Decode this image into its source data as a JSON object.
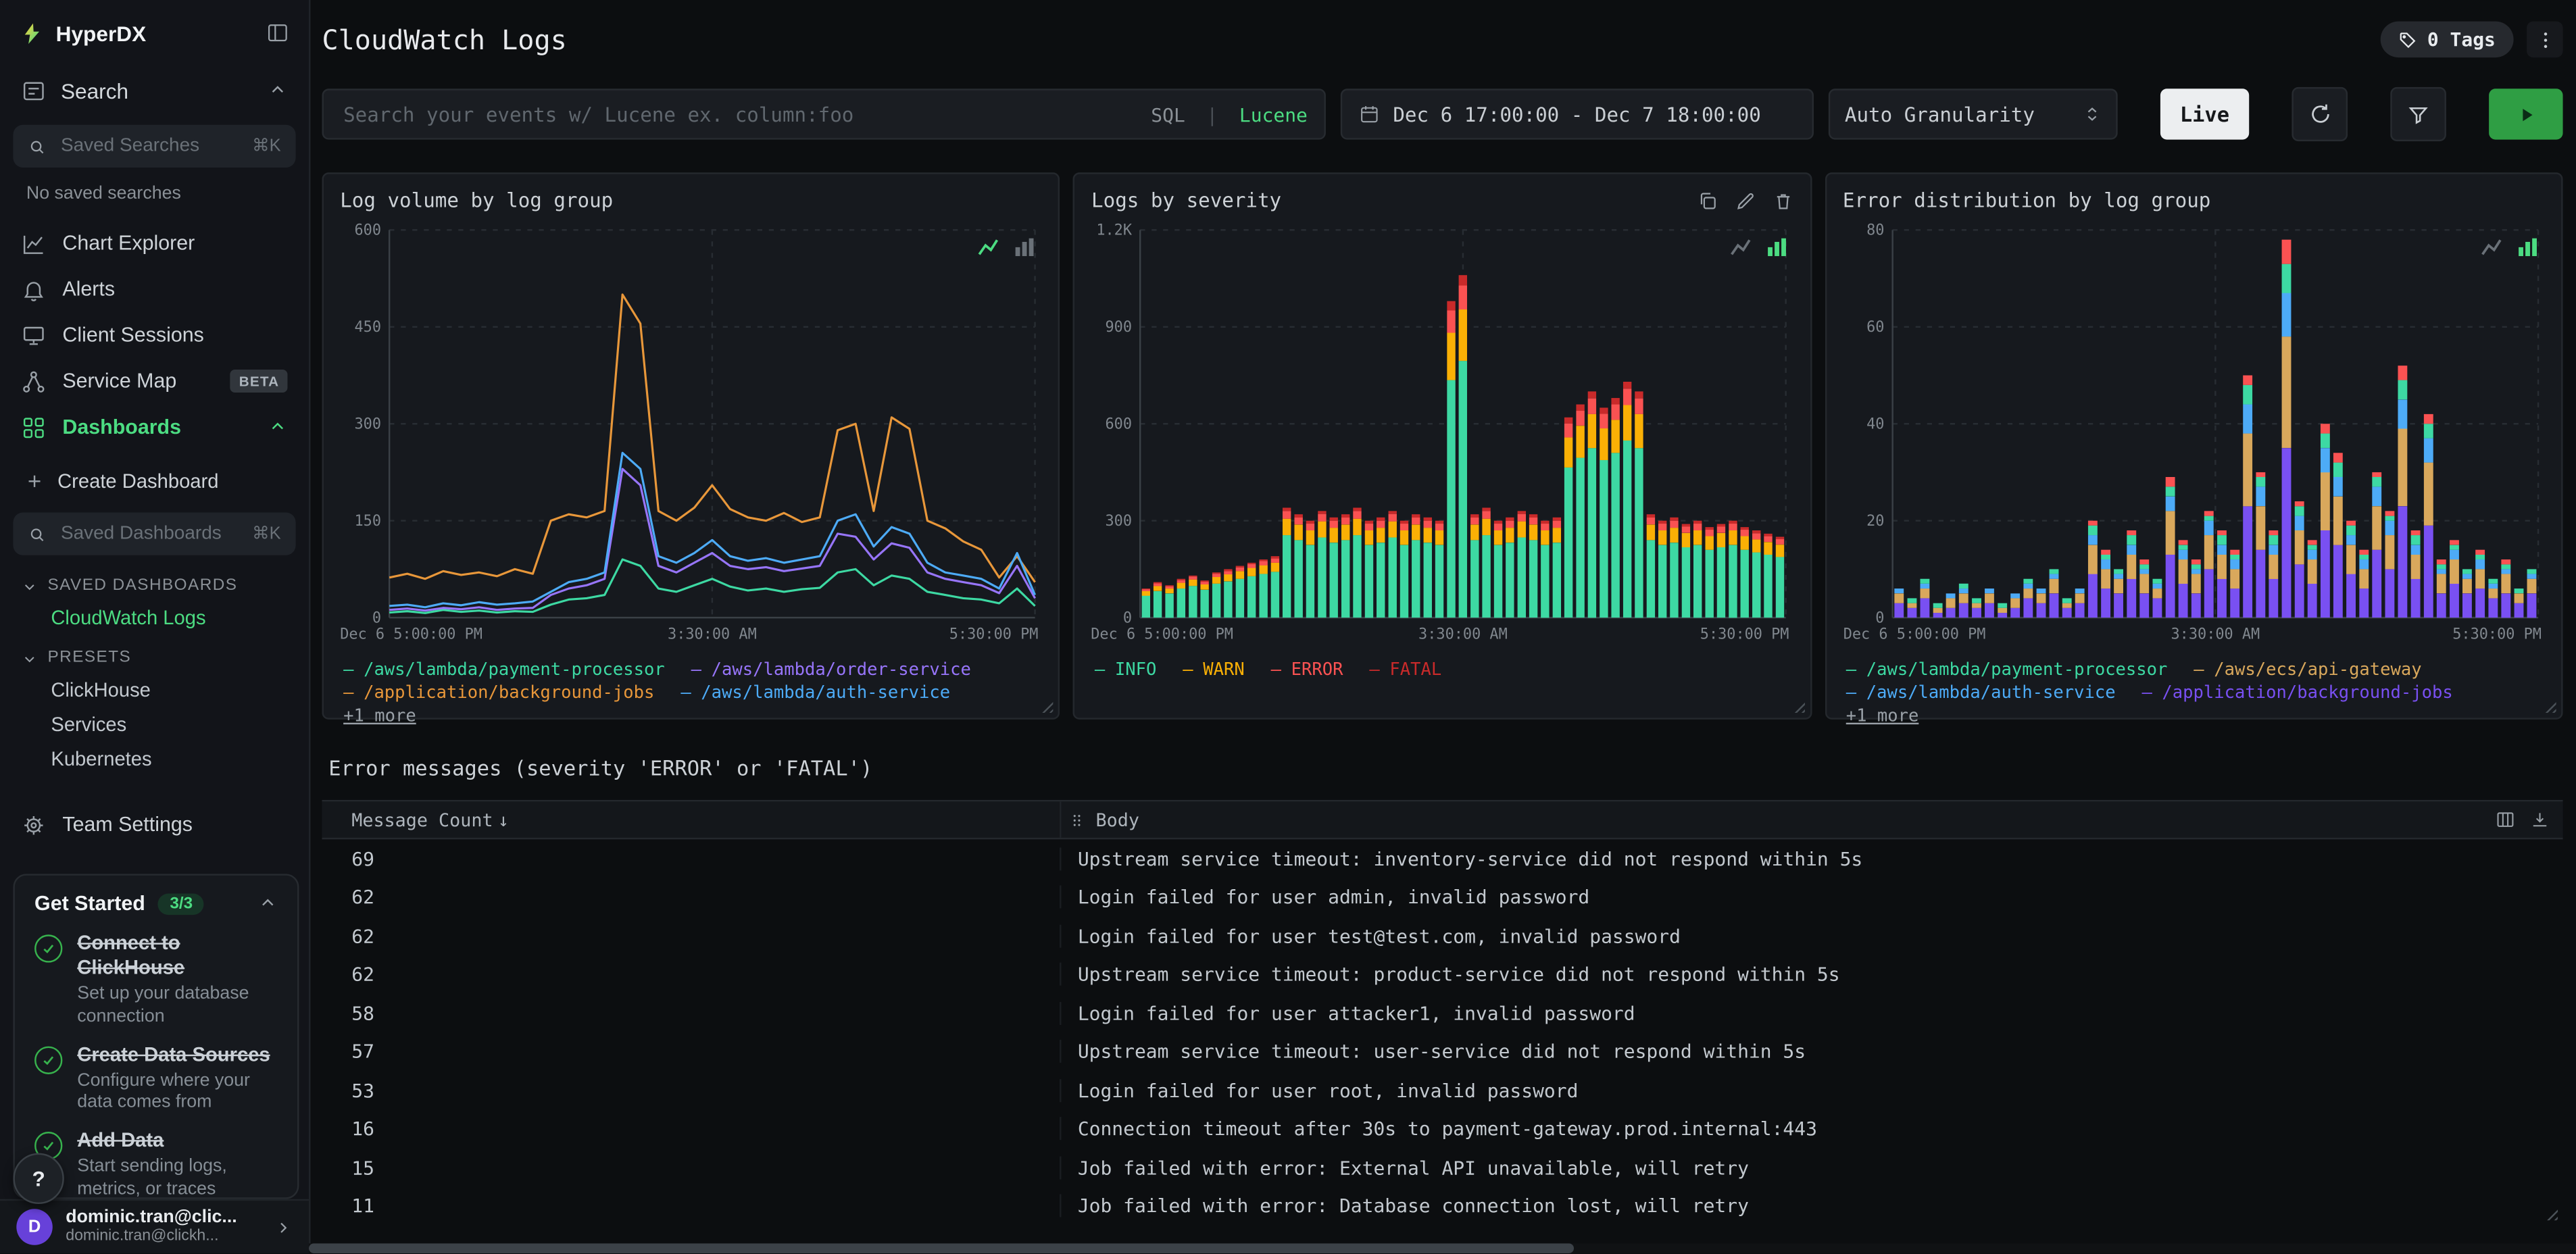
{
  "sidebar": {
    "logo_text": "HyperDX",
    "search": {
      "label": "Search"
    },
    "saved_searches": {
      "placeholder": "Saved Searches",
      "shortcut": "⌘K"
    },
    "no_saved_searches": "No saved searches",
    "nav": [
      {
        "label": "Chart Explorer"
      },
      {
        "label": "Alerts"
      },
      {
        "label": "Client Sessions"
      },
      {
        "label": "Service Map",
        "badge": "BETA"
      },
      {
        "label": "Dashboards"
      }
    ],
    "create_dashboard": "Create Dashboard",
    "saved_dashboards_input": {
      "placeholder": "Saved Dashboards",
      "shortcut": "⌘K"
    },
    "saved_dashboards_section": "SAVED DASHBOARDS",
    "saved_dashboards": [
      {
        "label": "CloudWatch Logs"
      }
    ],
    "presets_section": "PRESETS",
    "presets": [
      "ClickHouse",
      "Services",
      "Kubernetes"
    ],
    "team_settings": "Team Settings",
    "get_started": {
      "title": "Get Started",
      "badge": "3/3",
      "steps": [
        {
          "title": "Connect to ClickHouse",
          "desc": "Set up your database connection"
        },
        {
          "title": "Create Data Sources",
          "desc": "Configure where your data comes from"
        },
        {
          "title": "Add Data",
          "desc": "Start sending logs, metrics, or traces"
        }
      ]
    },
    "help": "?",
    "user": {
      "initial": "D",
      "name": "dominic.tran@clic...",
      "email": "dominic.tran@clickh..."
    }
  },
  "header": {
    "title": "CloudWatch Logs",
    "tags": "0 Tags"
  },
  "toolbar": {
    "search_placeholder": "Search your events w/ Lucene ex. column:foo",
    "sql": "SQL",
    "sep": "|",
    "lucene": "Lucene",
    "time_range": "Dec 6 17:00:00 - Dec 7 18:00:00",
    "granularity": "Auto Granularity",
    "live": "Live"
  },
  "errors": {
    "title": "Error messages (severity 'ERROR' or 'FATAL')"
  },
  "table": {
    "col_count": "Message Count",
    "sort_indicator": "↓",
    "col_body": "Body",
    "rows": [
      {
        "count": "69",
        "body": "Upstream service timeout: inventory-service did not respond within 5s"
      },
      {
        "count": "62",
        "body": "Login failed for user admin, invalid password"
      },
      {
        "count": "62",
        "body": "Login failed for user test@test.com, invalid password"
      },
      {
        "count": "62",
        "body": "Upstream service timeout: product-service did not respond within 5s"
      },
      {
        "count": "58",
        "body": "Login failed for user attacker1, invalid password"
      },
      {
        "count": "57",
        "body": "Upstream service timeout: user-service did not respond within 5s"
      },
      {
        "count": "53",
        "body": "Login failed for user root, invalid password"
      },
      {
        "count": "16",
        "body": "Connection timeout after 30s to payment-gateway.prod.internal:443"
      },
      {
        "count": "15",
        "body": "Job failed with error: External API unavailable, will retry"
      },
      {
        "count": "11",
        "body": "Job failed with error: Database connection lost, will retry"
      }
    ]
  },
  "chart_data": [
    {
      "type": "line",
      "title": "Log volume by log group",
      "ymax": 600,
      "yticks": [
        0,
        150,
        300,
        450,
        600
      ],
      "ytick_labels": [
        "0",
        "150",
        "300",
        "450",
        "600"
      ],
      "xtick_labels": [
        "Dec 6 5:00:00 PM",
        "3:30:00 AM",
        "5:30:00 PM"
      ],
      "series": [
        {
          "name": "/aws/lambda/payment-processor",
          "color": "#3dd9a3",
          "values": [
            8,
            10,
            7,
            12,
            9,
            11,
            8,
            10,
            9,
            20,
            28,
            30,
            35,
            90,
            80,
            45,
            40,
            50,
            60,
            48,
            42,
            45,
            40,
            44,
            46,
            70,
            75,
            50,
            65,
            60,
            40,
            35,
            30,
            28,
            22,
            45,
            18
          ]
        },
        {
          "name": "/aws/lambda/order-service",
          "color": "#9775fa",
          "values": [
            12,
            14,
            11,
            15,
            13,
            16,
            12,
            14,
            15,
            35,
            45,
            50,
            60,
            230,
            205,
            80,
            70,
            85,
            100,
            80,
            75,
            78,
            72,
            76,
            80,
            130,
            125,
            90,
            115,
            108,
            70,
            60,
            55,
            50,
            38,
            80,
            30
          ]
        },
        {
          "name": "/application/background-jobs",
          "color": "#e8973a",
          "values": [
            62,
            68,
            60,
            72,
            66,
            70,
            64,
            75,
            68,
            150,
            160,
            155,
            165,
            500,
            455,
            165,
            150,
            170,
            205,
            168,
            155,
            150,
            162,
            148,
            155,
            290,
            300,
            165,
            310,
            292,
            150,
            138,
            118,
            105,
            62,
            95,
            55
          ]
        },
        {
          "name": "/aws/lambda/auth-service",
          "color": "#4dabf7",
          "values": [
            18,
            20,
            16,
            22,
            19,
            24,
            20,
            22,
            25,
            40,
            55,
            60,
            70,
            255,
            230,
            95,
            85,
            100,
            120,
            95,
            88,
            92,
            85,
            90,
            95,
            150,
            160,
            110,
            140,
            130,
            85,
            70,
            65,
            60,
            45,
            100,
            35
          ]
        }
      ],
      "legend": [
        {
          "label": "/aws/lambda/payment-processor",
          "color": "#3dd9a3"
        },
        {
          "label": "/aws/lambda/order-service",
          "color": "#9775fa"
        },
        {
          "label": "/application/background-jobs",
          "color": "#e8973a"
        },
        {
          "label": "/aws/lambda/auth-service",
          "color": "#4dabf7"
        },
        {
          "label": "+1 more",
          "color": "#9aa1a8",
          "underline": true,
          "no_dash": true
        }
      ]
    },
    {
      "type": "stacked_bar",
      "title": "Logs by severity",
      "ymax": 1200,
      "yticks": [
        0,
        300,
        600,
        900,
        1200
      ],
      "ytick_labels": [
        "0",
        "300",
        "600",
        "900",
        "1.2K"
      ],
      "xtick_labels": [
        "Dec 6 5:00:00 PM",
        "3:30:00 AM",
        "5:30:00 PM"
      ],
      "series": [
        {
          "name": "INFO",
          "color": "#3dd9a3",
          "values": [
            68,
            82,
            75,
            90,
            98,
            86,
            105,
            112,
            120,
            128,
            135,
            142,
            255,
            240,
            225,
            248,
            232,
            240,
            255,
            225,
            232,
            248,
            225,
            240,
            232,
            225,
            735,
            795,
            240,
            255,
            225,
            232,
            248,
            240,
            225,
            232,
            465,
            495,
            525,
            488,
            510,
            548,
            525,
            240,
            225,
            232,
            218,
            225,
            210,
            218,
            225,
            210,
            202,
            195,
            188
          ]
        },
        {
          "name": "WARN",
          "color": "#fab005",
          "values": [
            14,
            16,
            15,
            18,
            20,
            17,
            21,
            22,
            24,
            26,
            27,
            28,
            51,
            48,
            45,
            50,
            46,
            48,
            51,
            45,
            46,
            50,
            45,
            48,
            46,
            45,
            147,
            159,
            48,
            51,
            45,
            46,
            50,
            48,
            45,
            46,
            93,
            99,
            105,
            98,
            102,
            110,
            105,
            48,
            45,
            46,
            44,
            45,
            42,
            44,
            45,
            42,
            40,
            39,
            38
          ]
        },
        {
          "name": "ERROR",
          "color": "#fa5252",
          "values": [
            6,
            8,
            7,
            8,
            9,
            8,
            10,
            10,
            11,
            12,
            13,
            13,
            24,
            22,
            21,
            23,
            22,
            22,
            24,
            21,
            22,
            23,
            21,
            22,
            22,
            21,
            69,
            74,
            22,
            24,
            21,
            22,
            23,
            22,
            21,
            22,
            43,
            46,
            49,
            45,
            48,
            51,
            49,
            22,
            21,
            22,
            20,
            21,
            20,
            20,
            21,
            20,
            19,
            18,
            17
          ]
        },
        {
          "name": "FATAL",
          "color": "#c92a2a",
          "values": [
            2,
            4,
            3,
            4,
            3,
            4,
            4,
            6,
            5,
            4,
            5,
            7,
            10,
            10,
            9,
            9,
            10,
            10,
            10,
            9,
            10,
            9,
            9,
            10,
            10,
            9,
            29,
            32,
            10,
            10,
            9,
            10,
            9,
            10,
            9,
            10,
            19,
            20,
            21,
            19,
            20,
            21,
            21,
            10,
            9,
            10,
            8,
            9,
            8,
            8,
            9,
            8,
            9,
            8,
            7
          ]
        }
      ],
      "legend": [
        {
          "label": "INFO",
          "color": "#3dd9a3"
        },
        {
          "label": "WARN",
          "color": "#fab005"
        },
        {
          "label": "ERROR",
          "color": "#fa5252"
        },
        {
          "label": "FATAL",
          "color": "#c92a2a"
        }
      ]
    },
    {
      "type": "stacked_bar",
      "title": "Error distribution by log group",
      "ymax": 80,
      "yticks": [
        0,
        20,
        40,
        60,
        80
      ],
      "ytick_labels": [
        "0",
        "20",
        "40",
        "60",
        "80"
      ],
      "xtick_labels": [
        "Dec 6 5:00:00 PM",
        "3:30:00 AM",
        "5:30:00 PM"
      ],
      "series": [
        {
          "name": "/application/background-jobs",
          "color": "#7950f2",
          "values": [
            3,
            2,
            4,
            1,
            2,
            3,
            2,
            3,
            1,
            2,
            4,
            3,
            5,
            2,
            3,
            9,
            6,
            5,
            8,
            5,
            4,
            13,
            7,
            5,
            10,
            8,
            6,
            23,
            14,
            8,
            35,
            11,
            7,
            18,
            15,
            9,
            6,
            14,
            10,
            23,
            8,
            19,
            5,
            7,
            5,
            6,
            4,
            5,
            3,
            5
          ]
        },
        {
          "name": "/aws/ecs/api-gateway",
          "color": "#d9a85c",
          "values": [
            2,
            1,
            2,
            1,
            2,
            2,
            1,
            2,
            1,
            2,
            2,
            2,
            3,
            1,
            2,
            6,
            4,
            3,
            5,
            4,
            2,
            9,
            5,
            4,
            7,
            5,
            4,
            15,
            9,
            5,
            23,
            7,
            5,
            12,
            10,
            6,
            4,
            9,
            7,
            16,
            5,
            13,
            4,
            5,
            3,
            4,
            2,
            4,
            2,
            3
          ]
        },
        {
          "name": "/aws/lambda/auth-service",
          "color": "#4dabf7",
          "values": [
            1,
            0,
            1,
            0,
            1,
            1,
            0,
            1,
            0,
            1,
            1,
            1,
            1,
            0,
            1,
            2,
            2,
            1,
            2,
            1,
            1,
            3,
            2,
            1,
            3,
            2,
            2,
            6,
            4,
            2,
            9,
            3,
            2,
            5,
            4,
            2,
            2,
            4,
            3,
            6,
            2,
            5,
            1,
            2,
            1,
            2,
            1,
            1,
            0,
            1
          ]
        },
        {
          "name": "/aws/lambda/payment-processor",
          "color": "#3dd9a3",
          "values": [
            0,
            1,
            1,
            1,
            0,
            1,
            1,
            0,
            1,
            0,
            1,
            0,
            1,
            1,
            0,
            2,
            1,
            1,
            2,
            1,
            1,
            2,
            1,
            1,
            1,
            2,
            1,
            4,
            2,
            2,
            6,
            2,
            1,
            3,
            3,
            2,
            1,
            2,
            1,
            4,
            2,
            3,
            1,
            1,
            1,
            1,
            1,
            1,
            1,
            1
          ]
        },
        {
          "name": "+1 more",
          "color": "#fa5252",
          "values": [
            0,
            0,
            0,
            0,
            0,
            0,
            0,
            0,
            0,
            0,
            0,
            0,
            0,
            0,
            0,
            1,
            1,
            0,
            1,
            1,
            0,
            2,
            1,
            1,
            1,
            1,
            1,
            2,
            1,
            1,
            5,
            1,
            1,
            2,
            2,
            1,
            1,
            1,
            1,
            3,
            1,
            2,
            1,
            1,
            0,
            1,
            0,
            1,
            0,
            0
          ]
        }
      ],
      "legend": [
        {
          "label": "/aws/lambda/payment-processor",
          "color": "#3dd9a3"
        },
        {
          "label": "/aws/ecs/api-gateway",
          "color": "#d9a85c"
        },
        {
          "label": "/aws/lambda/auth-service",
          "color": "#4dabf7"
        },
        {
          "label": "/application/background-jobs",
          "color": "#7950f2"
        },
        {
          "label": "+1 more",
          "color": "#9aa1a8",
          "underline": true,
          "no_dash": true
        }
      ]
    }
  ]
}
